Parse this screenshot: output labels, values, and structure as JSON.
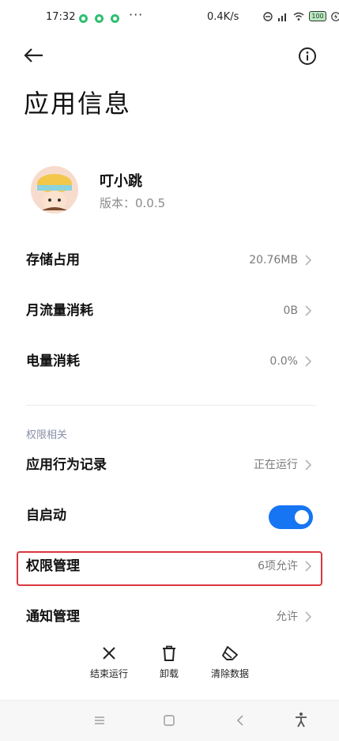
{
  "status_bar": {
    "time": "17:32",
    "more": "···",
    "network_speed": "0.4K/s",
    "battery": "100"
  },
  "header": {
    "title": "应用信息"
  },
  "app": {
    "name": "叮小跳",
    "version": "版本：0.0.5"
  },
  "rows": {
    "storage": {
      "label": "存储占用",
      "value": "20.76MB"
    },
    "traffic": {
      "label": "月流量消耗",
      "value": "0B"
    },
    "power": {
      "label": "电量消耗",
      "value": "0.0%"
    }
  },
  "permissions_section": {
    "title": "权限相关",
    "behavior": {
      "label": "应用行为记录",
      "value": "正在运行"
    },
    "autostart": {
      "label": "自启动",
      "enabled": true
    },
    "permission_manage": {
      "label": "权限管理",
      "value": "6项允许"
    },
    "notification": {
      "label": "通知管理",
      "value": "允许"
    }
  },
  "actions": {
    "force_stop": "结束运行",
    "uninstall": "卸载",
    "clear_data": "清除数据"
  },
  "colors": {
    "accent": "#1675f2",
    "highlight": "#d9363e",
    "status_green": "#2fbf71"
  }
}
